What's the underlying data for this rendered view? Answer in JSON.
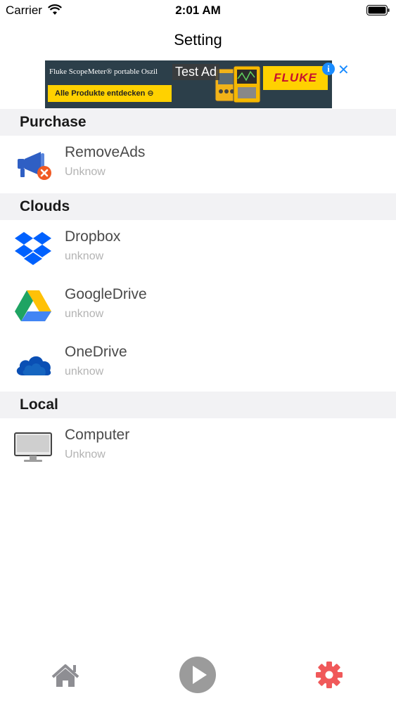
{
  "status_bar": {
    "carrier": "Carrier",
    "time": "2:01 AM"
  },
  "nav": {
    "title": "Setting"
  },
  "ad": {
    "headline": "Fluke ScopeMeter® portable Oszil",
    "cta": "Alle Produkte entdecken ⊖",
    "brand": "FLUKE",
    "test_label": "Test Ad",
    "info": "i",
    "close": "✕"
  },
  "sections": {
    "purchase": {
      "header": "Purchase",
      "items": [
        {
          "title": "RemoveAds",
          "subtitle": "Unknow",
          "icon": "megaphone-remove-icon"
        }
      ]
    },
    "clouds": {
      "header": "Clouds",
      "items": [
        {
          "title": "Dropbox",
          "subtitle": "unknow",
          "icon": "dropbox-icon"
        },
        {
          "title": "GoogleDrive",
          "subtitle": "unknow",
          "icon": "google-drive-icon"
        },
        {
          "title": "OneDrive",
          "subtitle": "unknow",
          "icon": "onedrive-icon"
        }
      ]
    },
    "local": {
      "header": "Local",
      "items": [
        {
          "title": "Computer",
          "subtitle": "Unknow",
          "icon": "computer-icon"
        }
      ]
    }
  },
  "tab_bar": {
    "tabs": [
      {
        "name": "home",
        "icon": "home-icon",
        "active": false
      },
      {
        "name": "play",
        "icon": "play-icon",
        "active": false
      },
      {
        "name": "settings",
        "icon": "gear-icon",
        "active": true
      }
    ]
  },
  "colors": {
    "active_tab": "#f0595a",
    "inactive_tab": "#8e8e93",
    "section_bg": "#f2f2f4"
  }
}
